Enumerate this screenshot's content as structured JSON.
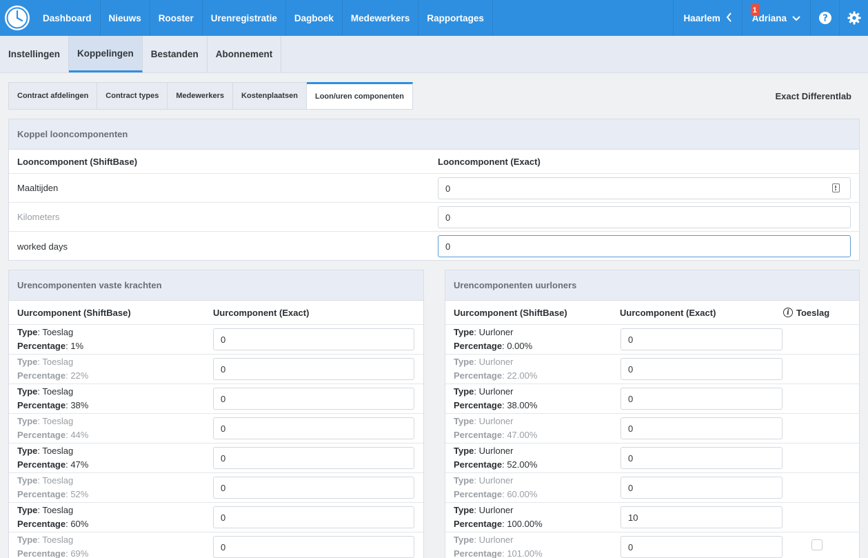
{
  "nav": {
    "items": [
      "Dashboard",
      "Nieuws",
      "Rooster",
      "Urenregistratie",
      "Dagboek",
      "Medewerkers",
      "Rapportages"
    ],
    "location": "Haarlem",
    "user": "Adriana",
    "notification_count": "1"
  },
  "subnav": {
    "items": [
      "Instellingen",
      "Koppelingen",
      "Bestanden",
      "Abonnement"
    ],
    "active": "Koppelingen"
  },
  "tabs": {
    "items": [
      "Contract afdelingen",
      "Contract types",
      "Medewerkers",
      "Kostenplaatsen",
      "Loon/uren componenten"
    ],
    "active": "Loon/uren componenten"
  },
  "integration_name": "Exact Differentlab",
  "loon": {
    "title": "Koppel looncomponenten",
    "col1": "Looncomponent (ShiftBase)",
    "col2": "Looncomponent (Exact)",
    "rows": [
      {
        "label": "Maaltijden",
        "value": "0"
      },
      {
        "label": "Kilometers",
        "value": "0"
      },
      {
        "label": "worked days",
        "value": "0"
      }
    ]
  },
  "vaste": {
    "title": "Urencomponenten vaste krachten",
    "col1": "Uurcomponent (ShiftBase)",
    "col2": "Uurcomponent (Exact)",
    "type_label": "Type",
    "pct_label": "Percentage",
    "rows": [
      {
        "type": "Toeslag",
        "pct": "1%",
        "value": "0"
      },
      {
        "type": "Toeslag",
        "pct": "22%",
        "value": "0"
      },
      {
        "type": "Toeslag",
        "pct": "38%",
        "value": "0"
      },
      {
        "type": "Toeslag",
        "pct": "44%",
        "value": "0"
      },
      {
        "type": "Toeslag",
        "pct": "47%",
        "value": "0"
      },
      {
        "type": "Toeslag",
        "pct": "52%",
        "value": "0"
      },
      {
        "type": "Toeslag",
        "pct": "60%",
        "value": "0"
      },
      {
        "type": "Toeslag",
        "pct": "69%",
        "value": "0"
      }
    ]
  },
  "uurloners": {
    "title": "Urencomponenten uurloners",
    "col1": "Uurcomponent (ShiftBase)",
    "col2": "Uurcomponent (Exact)",
    "col3": "Toeslag",
    "type_label": "Type",
    "pct_label": "Percentage",
    "rows": [
      {
        "type": "Uurloner",
        "pct": "0.00%",
        "value": "0"
      },
      {
        "type": "Uurloner",
        "pct": "22.00%",
        "value": "0"
      },
      {
        "type": "Uurloner",
        "pct": "38.00%",
        "value": "0"
      },
      {
        "type": "Uurloner",
        "pct": "47.00%",
        "value": "0"
      },
      {
        "type": "Uurloner",
        "pct": "52.00%",
        "value": "0"
      },
      {
        "type": "Uurloner",
        "pct": "60.00%",
        "value": "0"
      },
      {
        "type": "Uurloner",
        "pct": "100.00%",
        "value": "10"
      },
      {
        "type": "Uurloner",
        "pct": "101.00%",
        "value": "0"
      }
    ]
  }
}
